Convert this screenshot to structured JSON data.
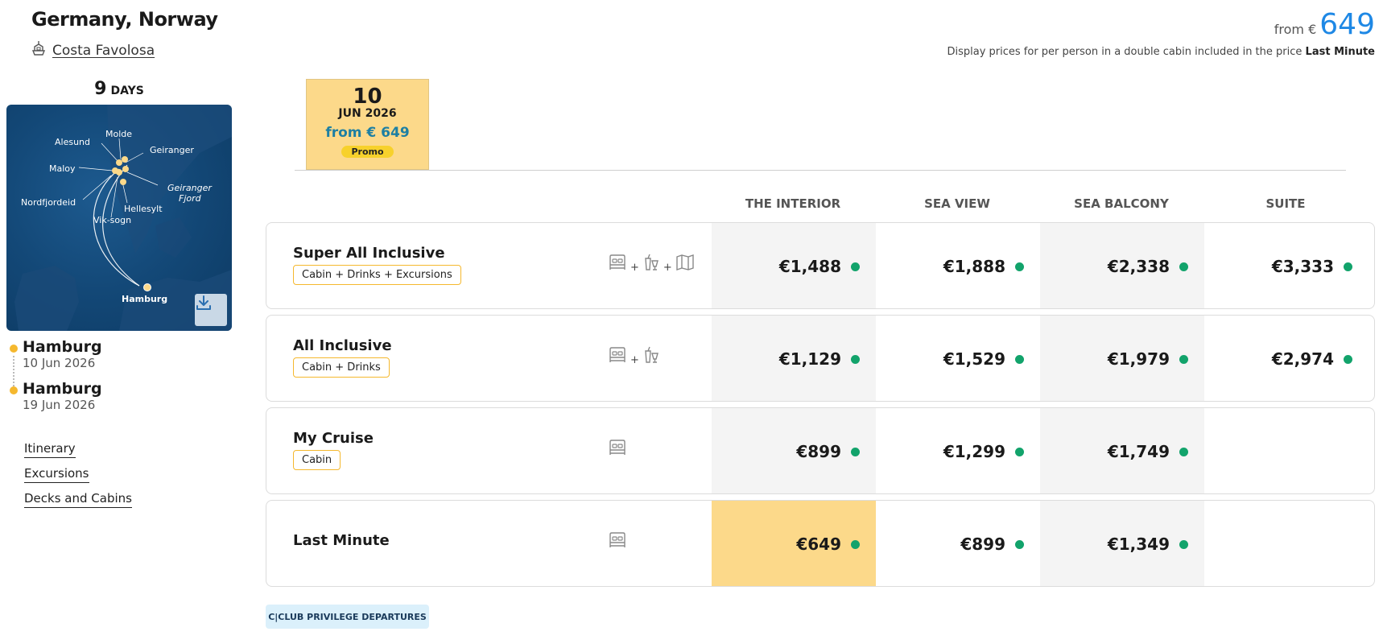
{
  "header": {
    "title": "Germany, Norway",
    "ship_name": "Costa Favolosa",
    "from_label": "from €",
    "from_price": "649",
    "disclaimer_text": "Display prices for per person in a double cabin included in the price",
    "disclaimer_bold": "Last Minute"
  },
  "duration": {
    "number": "9",
    "label": "DAYS"
  },
  "map": {
    "labels": [
      "Molde",
      "Alesund",
      "Geiranger",
      "Maloy",
      "Geiranger",
      "Fjord",
      "Nordfjordeid",
      "Hellesylt",
      "Vik-sogn",
      "Hamburg"
    ],
    "download_icon": "download-icon"
  },
  "route": {
    "departure": {
      "city": "Hamburg",
      "date": "10 Jun 2026"
    },
    "arrival": {
      "city": "Hamburg",
      "date": "19 Jun 2026"
    }
  },
  "side_links": [
    "Itinerary",
    "Excursions",
    "Decks and Cabins"
  ],
  "date_tab": {
    "day": "10",
    "month": "JUN 2026",
    "from_price": "from € 649",
    "badge": "Promo"
  },
  "columns": [
    "THE INTERIOR",
    "SEA VIEW",
    "SEA BALCONY",
    "SUITE"
  ],
  "fares": [
    {
      "name": "Super All Inclusive",
      "tag": "Cabin + Drinks + Excursions",
      "icons": [
        "bed-icon",
        "drinks-icon",
        "map-icon"
      ],
      "prices": [
        "€1,488",
        "€1,888",
        "€2,338",
        "€3,333"
      ]
    },
    {
      "name": "All Inclusive",
      "tag": "Cabin + Drinks",
      "icons": [
        "bed-icon",
        "drinks-icon"
      ],
      "prices": [
        "€1,129",
        "€1,529",
        "€1,979",
        "€2,974"
      ]
    },
    {
      "name": "My Cruise",
      "tag": "Cabin",
      "icons": [
        "bed-icon"
      ],
      "prices": [
        "€899",
        "€1,299",
        "€1,749",
        ""
      ]
    },
    {
      "name": "Last Minute",
      "tag": "",
      "icons": [
        "bed-icon"
      ],
      "prices": [
        "€649",
        "€899",
        "€1,349",
        ""
      ]
    }
  ],
  "colors": {
    "accent_blue": "#1e88e5",
    "gold": "#fcd98a",
    "available_green": "#12a36b",
    "tag_border": "#f5b82e"
  },
  "club_button": "C|CLUB PRIVILEGE DEPARTURES"
}
